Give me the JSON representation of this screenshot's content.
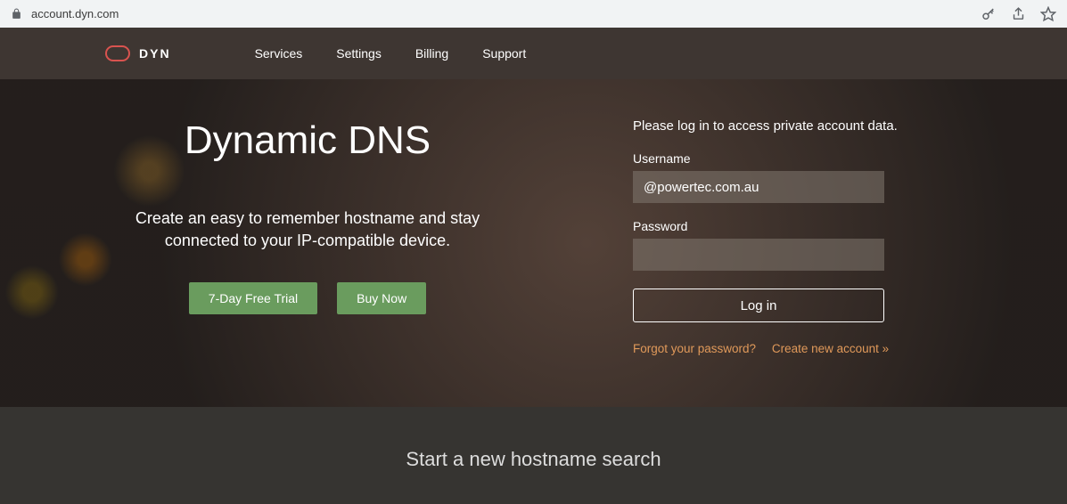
{
  "browser": {
    "url": "account.dyn.com"
  },
  "brand": {
    "name": "DYN"
  },
  "nav": {
    "items": [
      "Services",
      "Settings",
      "Billing",
      "Support"
    ]
  },
  "hero": {
    "title": "Dynamic DNS",
    "subtitle": "Create an easy to remember hostname and stay connected to your IP-compatible device.",
    "trial_btn": "7-Day Free Trial",
    "buy_btn": "Buy Now"
  },
  "login": {
    "prompt": "Please log in to access private account data.",
    "username_label": "Username",
    "username_value": "@powertec.com.au",
    "password_label": "Password",
    "password_value": "",
    "login_btn": "Log in",
    "forgot_link": "Forgot your password?",
    "create_link": "Create new account »"
  },
  "search": {
    "heading": "Start a new hostname search"
  }
}
